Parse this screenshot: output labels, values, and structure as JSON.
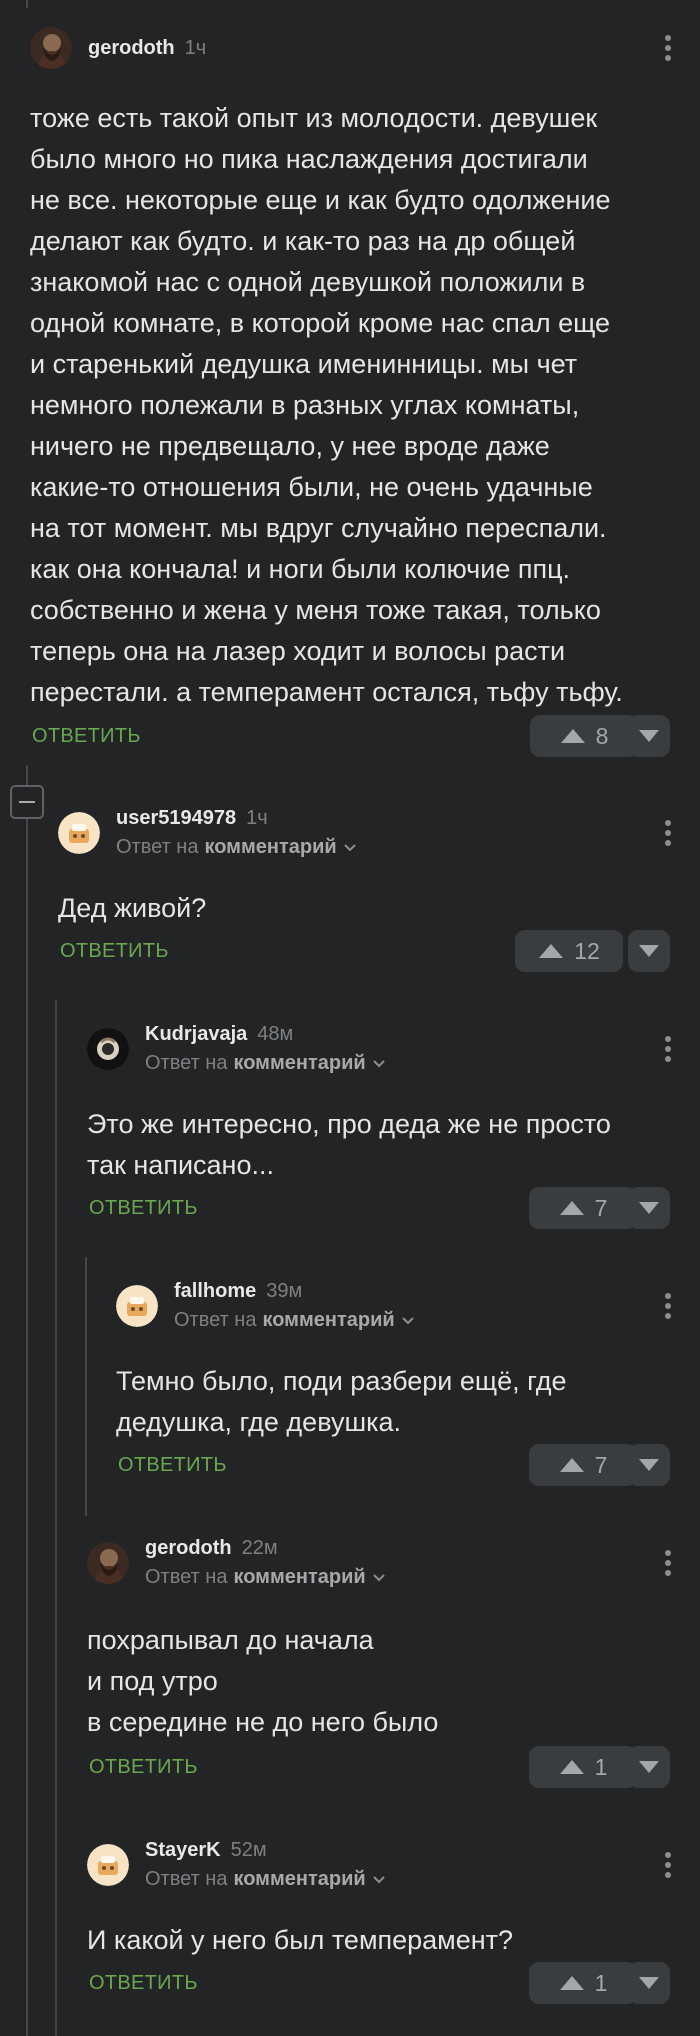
{
  "labels": {
    "reply_prefix": "Ответ на",
    "reply_target": "комментарий",
    "reply_action": "ОТВЕТИТЬ"
  },
  "comments": [
    {
      "author": "gerodoth",
      "time": "1ч",
      "text_lines": [
        "тоже есть такой опыт из молодости. девушек",
        "было много но пика наслаждения достигали",
        "не все. некоторые еще и как будто одолжение",
        "делают как будто. и как-то раз на др общей",
        "знакомой нас с одной девушкой положили в",
        "одной комнате, в которой кроме нас спал еще",
        "и старенький дедушка именинницы. мы чет",
        "немного полежали в разных углах комнаты,",
        "ничего не предвещало, у нее вроде даже",
        "какие-то отношения были, не очень удачные",
        "на тот момент. мы вдруг случайно переспали.",
        "как она кончала! и ноги были колючие ппц.",
        "собственно и жена у меня тоже такая, только",
        "теперь она на лазер ходит и волосы расти",
        "перестали. а темперамент остался, тьфу тьфу."
      ],
      "votes": "8"
    },
    {
      "author": "user5194978",
      "time": "1ч",
      "text_lines": [
        "Дед живой?"
      ],
      "votes": "12"
    },
    {
      "author": "Kudrjavaja",
      "time": "48м",
      "text_lines": [
        "Это же интересно, про деда же не просто",
        "так написано..."
      ],
      "votes": "7"
    },
    {
      "author": "fallhome",
      "time": "39м",
      "text_lines": [
        "Темно было, поди разбери ещё, где",
        "дедушка, где девушка."
      ],
      "votes": "7"
    },
    {
      "author": "gerodoth",
      "time": "22м",
      "text_lines": [
        "похрапывал до начала",
        "и под утро",
        "в середине не до него было"
      ],
      "votes": "1"
    },
    {
      "author": "StayerK",
      "time": "52м",
      "text_lines": [
        "И какой у него был темперамент?"
      ],
      "votes": "1"
    }
  ],
  "colors": {
    "background": "#222426",
    "reply_green": "#6aa84f",
    "vote_bg": "#3a3d40",
    "thread_line": "#45484b"
  },
  "icons": [
    "dots-menu-icon",
    "upvote-icon",
    "downvote-icon",
    "chevron-down-icon",
    "collapse-icon"
  ]
}
